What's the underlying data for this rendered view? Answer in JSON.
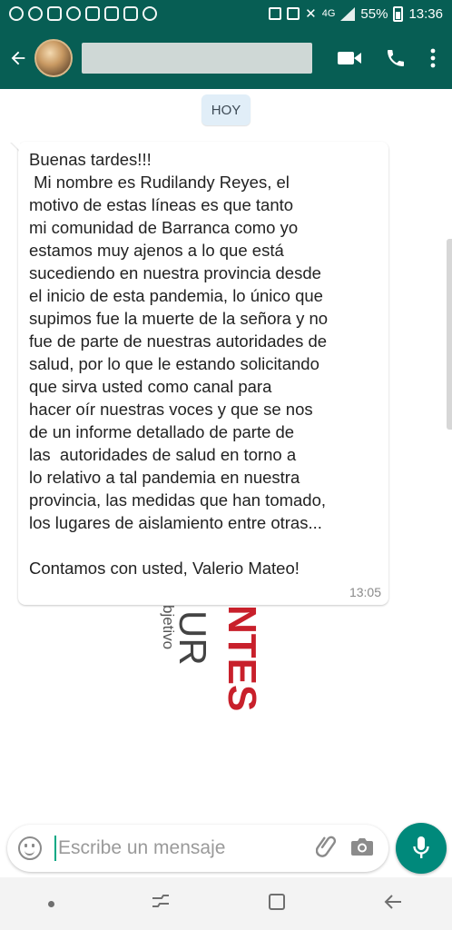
{
  "status_bar": {
    "battery": "55%",
    "time": "13:36",
    "network": "4G"
  },
  "header": {
    "contact_name": ""
  },
  "chat": {
    "date_chip": "HOY",
    "message": {
      "lines": [
        "Buenas tardes!!!",
        " Mi nombre es Rudilandy Reyes, el",
        "motivo de estas líneas es que tanto",
        "mi comunidad de Barranca como yo",
        "estamos muy ajenos a lo que está",
        "sucediendo en nuestra provincia desde",
        "el inicio de esta pandemia, lo único que",
        "supimos fue la muerte de la señora y no",
        "fue de parte de nuestras autoridades de",
        "salud, por lo que le estando solicitando",
        "que sirva usted como canal para",
        "hacer oír nuestras voces y que se nos",
        "de un informe detallado de parte de",
        "las  autoridades de salud en torno a",
        "lo relativo a tal pandemia en nuestra",
        "provincia, las medidas que han tomado,",
        "los lugares de aislamiento entre otras...",
        "",
        "Contamos con usted, Valerio Mateo!"
      ],
      "time": "13:05"
    },
    "background_fragment": {
      "gray_text": "bjetivo",
      "red_text": "NTES",
      "red_text_2": "UR"
    }
  },
  "input": {
    "placeholder": "Escribe un mensaje"
  },
  "colors": {
    "header": "#075e54",
    "accent": "#00897b",
    "bubble": "#ffffff",
    "date_chip": "#e1eef8"
  }
}
